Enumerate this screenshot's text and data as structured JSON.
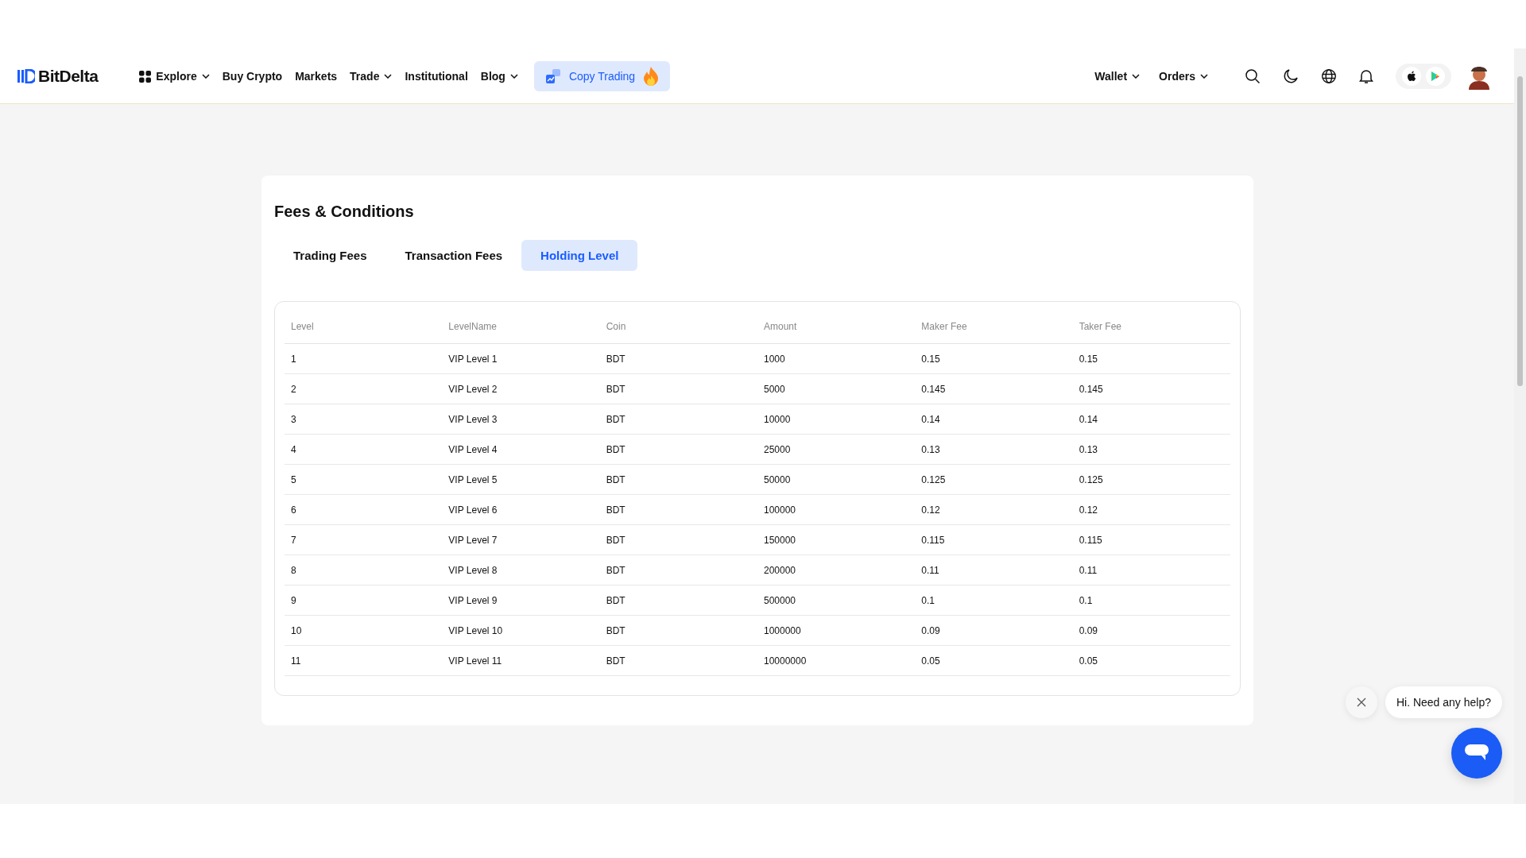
{
  "header": {
    "logo": "BitDelta",
    "nav": [
      {
        "label": "Explore",
        "kind": "grid",
        "dropdown": true
      },
      {
        "label": "Buy Crypto",
        "kind": "plain",
        "dropdown": false
      },
      {
        "label": "Markets",
        "kind": "plain",
        "dropdown": false
      },
      {
        "label": "Trade",
        "kind": "plain",
        "dropdown": true
      },
      {
        "label": "Institutional",
        "kind": "plain",
        "dropdown": false
      },
      {
        "label": "Blog",
        "kind": "plain",
        "dropdown": true
      }
    ],
    "promo": "Copy Trading",
    "right_menus": [
      {
        "label": "Wallet",
        "dropdown": true
      },
      {
        "label": "Orders",
        "dropdown": true
      }
    ]
  },
  "card": {
    "title": "Fees & Conditions",
    "tabs": [
      {
        "label": "Trading Fees",
        "selected": false
      },
      {
        "label": "Transaction Fees",
        "selected": false
      },
      {
        "label": "Holding Level",
        "selected": true
      }
    ],
    "table": {
      "columns": [
        "Level",
        "LevelName",
        "Coin",
        "Amount",
        "Maker Fee",
        "Taker Fee"
      ],
      "rows": [
        [
          "1",
          "VIP Level 1",
          "BDT",
          "1000",
          "0.15",
          "0.15"
        ],
        [
          "2",
          "VIP Level 2",
          "BDT",
          "5000",
          "0.145",
          "0.145"
        ],
        [
          "3",
          "VIP Level 3",
          "BDT",
          "10000",
          "0.14",
          "0.14"
        ],
        [
          "4",
          "VIP Level 4",
          "BDT",
          "25000",
          "0.13",
          "0.13"
        ],
        [
          "5",
          "VIP Level 5",
          "BDT",
          "50000",
          "0.125",
          "0.125"
        ],
        [
          "6",
          "VIP Level 6",
          "BDT",
          "100000",
          "0.12",
          "0.12"
        ],
        [
          "7",
          "VIP Level 7",
          "BDT",
          "150000",
          "0.115",
          "0.115"
        ],
        [
          "8",
          "VIP Level 8",
          "BDT",
          "200000",
          "0.11",
          "0.11"
        ],
        [
          "9",
          "VIP Level 9",
          "BDT",
          "500000",
          "0.1",
          "0.1"
        ],
        [
          "10",
          "VIP Level 10",
          "BDT",
          "1000000",
          "0.09",
          "0.09"
        ],
        [
          "11",
          "VIP Level 11",
          "BDT",
          "10000000",
          "0.05",
          "0.05"
        ]
      ]
    }
  },
  "chat": {
    "greeting": "Hi. Need any help?"
  }
}
